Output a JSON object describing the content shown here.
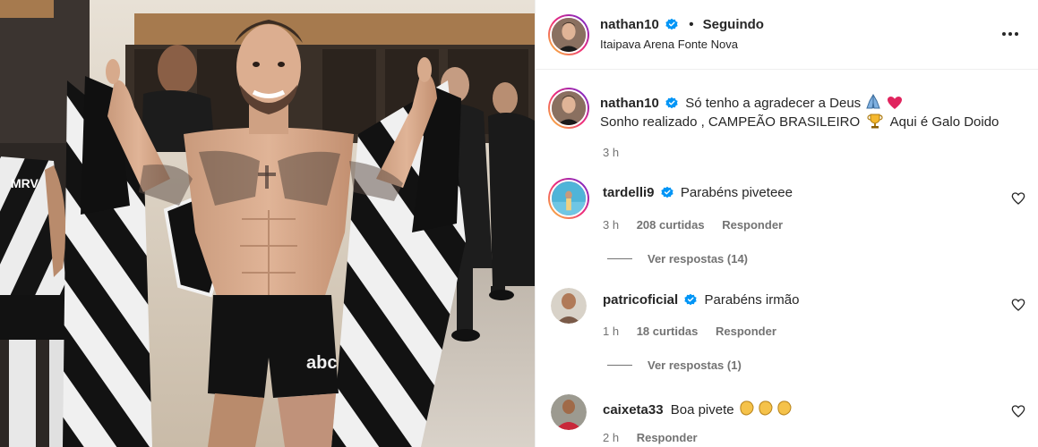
{
  "post": {
    "author": "nathan10",
    "follow_status": "Seguindo",
    "separator": "•",
    "location": "Itaipava Arena Fonte Nova",
    "caption_line1": "Só tenho a agradecer a Deus",
    "caption_line2": "Sonho realizado , CAMPEÃO BRASILEIRO",
    "caption_line2_suffix": "Aqui é Galo Doido",
    "caption_time": "3 h"
  },
  "comments": [
    {
      "username": "tardelli9",
      "verified": true,
      "text": "Parabéns piveteee",
      "time": "3 h",
      "likes": "208 curtidas",
      "reply_label": "Responder",
      "view_replies": "Ver respostas (14)"
    },
    {
      "username": "patricoficial",
      "verified": true,
      "text": "Parabéns irmão",
      "time": "1 h",
      "likes": "18 curtidas",
      "reply_label": "Responder",
      "view_replies": "Ver respostas (1)"
    },
    {
      "username": "caixeta33",
      "verified": false,
      "text": "Boa pivete",
      "time": "2 h",
      "reply_label": "Responder"
    }
  ],
  "photo": {
    "shorts_brand": "abc",
    "flag_colors": [
      "#111111",
      "#f2f2f2"
    ]
  },
  "colors": {
    "verified_blue": "#0095f6",
    "heart_red": "#e0245e",
    "text_primary": "#262626",
    "text_secondary": "#737373"
  }
}
